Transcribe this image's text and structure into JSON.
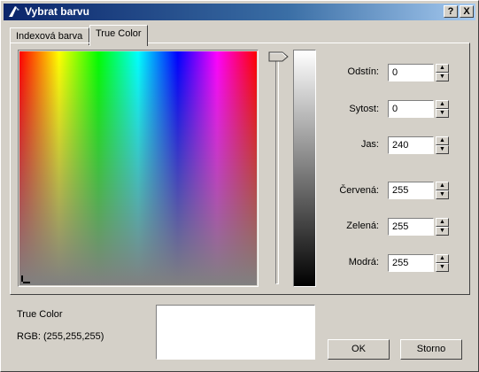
{
  "window": {
    "title": "Vybrat barvu",
    "help_label": "?",
    "close_label": "X"
  },
  "tabs": [
    {
      "label": "Indexová barva",
      "active": false
    },
    {
      "label": "True Color",
      "active": true
    }
  ],
  "fields": {
    "hue": {
      "label": "Odstín:",
      "value": "0"
    },
    "saturation": {
      "label": "Sytost:",
      "value": "0"
    },
    "luminance": {
      "label": "Jas:",
      "value": "240"
    },
    "red": {
      "label": "Červená:",
      "value": "255"
    },
    "green": {
      "label": "Zelená:",
      "value": "255"
    },
    "blue": {
      "label": "Modrá:",
      "value": "255"
    }
  },
  "info": {
    "title": "True Color",
    "rgb": "RGB: (255,255,255)"
  },
  "preview_color": "#ffffff",
  "buttons": {
    "ok": "OK",
    "cancel": "Storno"
  },
  "icons": {
    "title": "color-picker-icon",
    "spin_up": "arrow-up-icon",
    "spin_down": "arrow-down-icon"
  }
}
